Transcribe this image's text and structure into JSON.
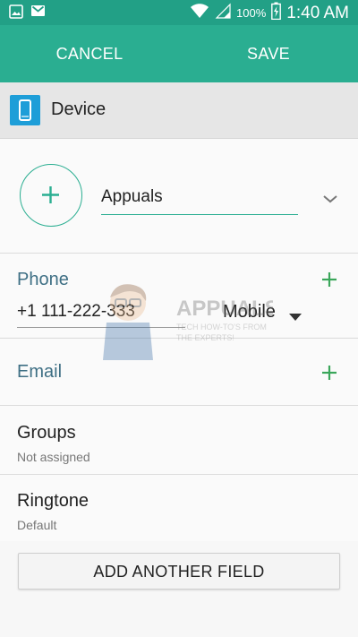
{
  "status_bar": {
    "battery_percent": "100%",
    "time": "1:40 AM",
    "icons": [
      "gallery-icon",
      "gmail-icon",
      "wifi-icon",
      "signal-icon",
      "battery-charging-icon"
    ]
  },
  "action_bar": {
    "cancel_label": "CANCEL",
    "save_label": "SAVE"
  },
  "account": {
    "label": "Device",
    "icon": "device-icon"
  },
  "name": {
    "value": "Appuals"
  },
  "phone": {
    "title": "Phone",
    "number": "+1 111-222-333",
    "type": "Mobile"
  },
  "email": {
    "title": "Email"
  },
  "groups": {
    "title": "Groups",
    "value": "Not assigned"
  },
  "ringtone": {
    "title": "Ringtone",
    "value": "Default"
  },
  "add_field_label": "ADD ANOTHER FIELD",
  "watermark": {
    "brand": "APPUALS",
    "tagline_1": "TECH HOW-TO'S FROM",
    "tagline_2": "THE EXPERTS!"
  },
  "colors": {
    "status_bar": "#22a086",
    "action_bar": "#2aae91",
    "accent_green": "#2aae91",
    "section_title": "#3e6f84",
    "device_icon": "#1e9ed8"
  }
}
